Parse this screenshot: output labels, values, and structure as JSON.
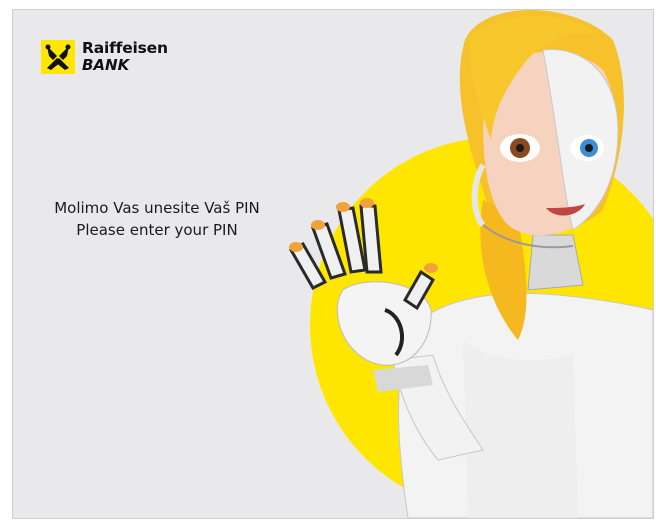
{
  "brand": {
    "name_line1": "Raiffeisen",
    "name_line2": "BANK",
    "logo_icon": "raiffeisen-crossed-horse-heads-icon",
    "accent_color": "#ffe600"
  },
  "prompt": {
    "line1": "Molimo Vas unesite Vaš PIN",
    "line2": "Please enter your PIN"
  },
  "colors": {
    "background": "#e9e9eb",
    "circle": "#ffe600",
    "text": "#1b1b1b"
  }
}
